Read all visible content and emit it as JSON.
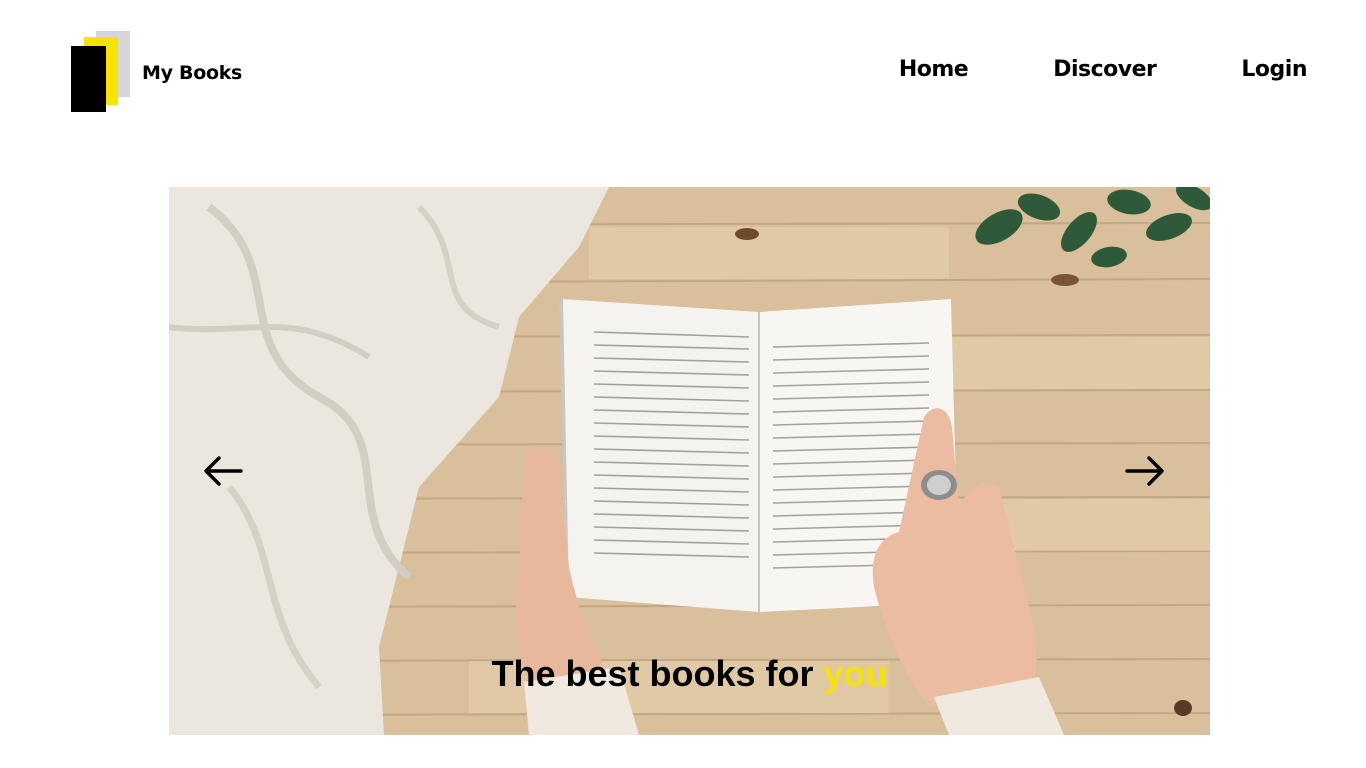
{
  "header": {
    "brand": "My Books",
    "nav": [
      {
        "label": "Home"
      },
      {
        "label": "Discover"
      },
      {
        "label": "Login"
      }
    ]
  },
  "hero": {
    "caption_prefix": "The best books for ",
    "caption_highlight": "you",
    "image_alt": "Hands holding an open book on a wooden table"
  },
  "colors": {
    "accent": "#f5e400",
    "logo_gray": "#d6d6d9",
    "text": "#000000"
  },
  "icons": {
    "prev": "arrow-left-icon",
    "next": "arrow-right-icon"
  }
}
